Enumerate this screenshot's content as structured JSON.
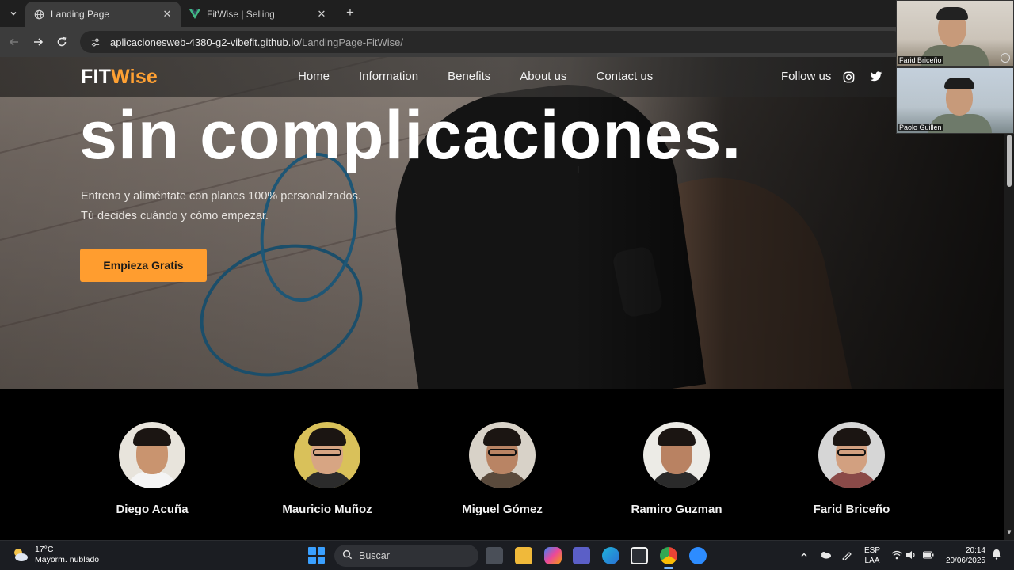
{
  "browser": {
    "tabs": [
      {
        "title": "Landing Page",
        "active": true
      },
      {
        "title": "FitWise | Selling",
        "active": false
      }
    ],
    "new_tab_symbol": "+",
    "url_domain": "aplicacionesweb-4380-g2-vibefit.github.io",
    "url_path": "/LandingPage-FitWise/"
  },
  "site": {
    "brand_part1": "FIT",
    "brand_part2": "Wise",
    "brand_colors": {
      "primary": "#ffffff",
      "accent": "#ffa133"
    },
    "nav": [
      "Home",
      "Information",
      "Benefits",
      "About us",
      "Contact us"
    ],
    "follow_label": "Follow us",
    "social_icons": [
      "instagram-icon",
      "twitter-icon"
    ]
  },
  "hero": {
    "title": "sin complicaciones.",
    "subtitle_line1": "Entrena y aliméntate con planes 100% personalizados.",
    "subtitle_line2": "Tú decides cuándo y cómo empezar.",
    "cta_label": "Empieza Gratis",
    "cta_color": "#ff9d2f"
  },
  "team": [
    {
      "name": "Diego Acuña"
    },
    {
      "name": "Mauricio Muñoz"
    },
    {
      "name": "Miguel Gómez"
    },
    {
      "name": "Ramiro Guzman"
    },
    {
      "name": "Farid Briceño"
    }
  ],
  "video_call": [
    {
      "participant": "Farid Briceño"
    },
    {
      "participant": "Paolo Guillen"
    }
  ],
  "taskbar": {
    "weather_temp": "17°C",
    "weather_desc": "Mayorm. nublado",
    "search_placeholder": "Buscar",
    "lang_line1": "ESP",
    "lang_line2": "LAA",
    "time": "20:14",
    "date": "20/06/2025"
  }
}
